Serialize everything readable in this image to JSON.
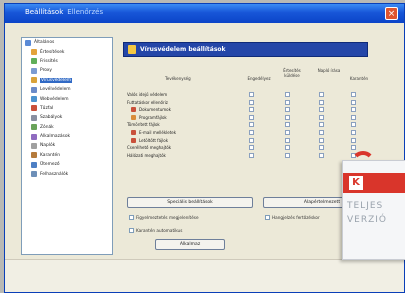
{
  "window": {
    "title": "Beállítások",
    "subtitle": "Ellenőrzés",
    "close_glyph": "×"
  },
  "sidebar": {
    "items": [
      {
        "label": "Általános",
        "icon": "settings-icon",
        "color": "#5a8ad6"
      },
      {
        "label": "Értesítések",
        "icon": "bell-icon",
        "color": "#e3a33a"
      },
      {
        "label": "Frissítés",
        "icon": "update-icon",
        "color": "#5fae5a"
      },
      {
        "label": "Proxy",
        "icon": "network-icon",
        "color": "#7b9bd1"
      },
      {
        "label": "Vírusvédelem",
        "icon": "shield-icon",
        "color": "#d9a23a",
        "selected": true
      },
      {
        "label": "Levélvédelem",
        "icon": "mail-icon",
        "color": "#6b8bc9"
      },
      {
        "label": "Webvédelem",
        "icon": "globe-icon",
        "color": "#4c93cf"
      },
      {
        "label": "Tűzfal",
        "icon": "firewall-icon",
        "color": "#c9503a"
      },
      {
        "label": "Szabályok",
        "icon": "rules-icon",
        "color": "#8a8fa0"
      },
      {
        "label": "Zónák",
        "icon": "zones-icon",
        "color": "#6aa35a"
      },
      {
        "label": "Alkalmazások",
        "icon": "app-icon",
        "color": "#8f6bc0"
      },
      {
        "label": "Naplók",
        "icon": "log-icon",
        "color": "#a0a0a0"
      },
      {
        "label": "Karantén",
        "icon": "quarantine-icon",
        "color": "#b57b3c"
      },
      {
        "label": "Ütemező",
        "icon": "clock-icon",
        "color": "#4d7fc4"
      },
      {
        "label": "Felhasználók",
        "icon": "user-icon",
        "color": "#6d8fb8"
      }
    ]
  },
  "panel": {
    "header_title": "Vírusvédelem beállítások",
    "columns": {
      "name": "Tevékenység",
      "c1": "Engedélyez",
      "c2": "Értesítés küldése",
      "c3": "Napló írása",
      "c4": "Karantén"
    },
    "rows": [
      {
        "label": "Valós idejű védelem",
        "indent": false
      },
      {
        "label": "Futtatáskor ellenőriz",
        "indent": false
      },
      {
        "label": "Dokumentumok",
        "indent": true,
        "color": "#c9503a"
      },
      {
        "label": "Programfájlok",
        "indent": true,
        "color": "#d98c3a"
      },
      {
        "label": "Tömörített fájlok",
        "indent": false
      },
      {
        "label": "E-mail mellékletek",
        "indent": true,
        "color": "#c9503a"
      },
      {
        "label": "Letöltött fájlok",
        "indent": true,
        "color": "#c9503a"
      },
      {
        "label": "Cserélhető meghajtók",
        "indent": false
      },
      {
        "label": "Hálózati meghajtók",
        "indent": false
      }
    ],
    "buttons": {
      "left": "Speciális beállítások",
      "right": "Alapértelmezett",
      "bottom": "Alkalmaz"
    },
    "options": {
      "o1": "Figyelmeztetés megjelenítése",
      "o2": "Karantén automatikus",
      "o3": "Hangjelzés fertőzéskor"
    }
  },
  "overlay": {
    "logo_letter": "K",
    "line1": "TELJES",
    "line2": "VERZIÓ"
  }
}
